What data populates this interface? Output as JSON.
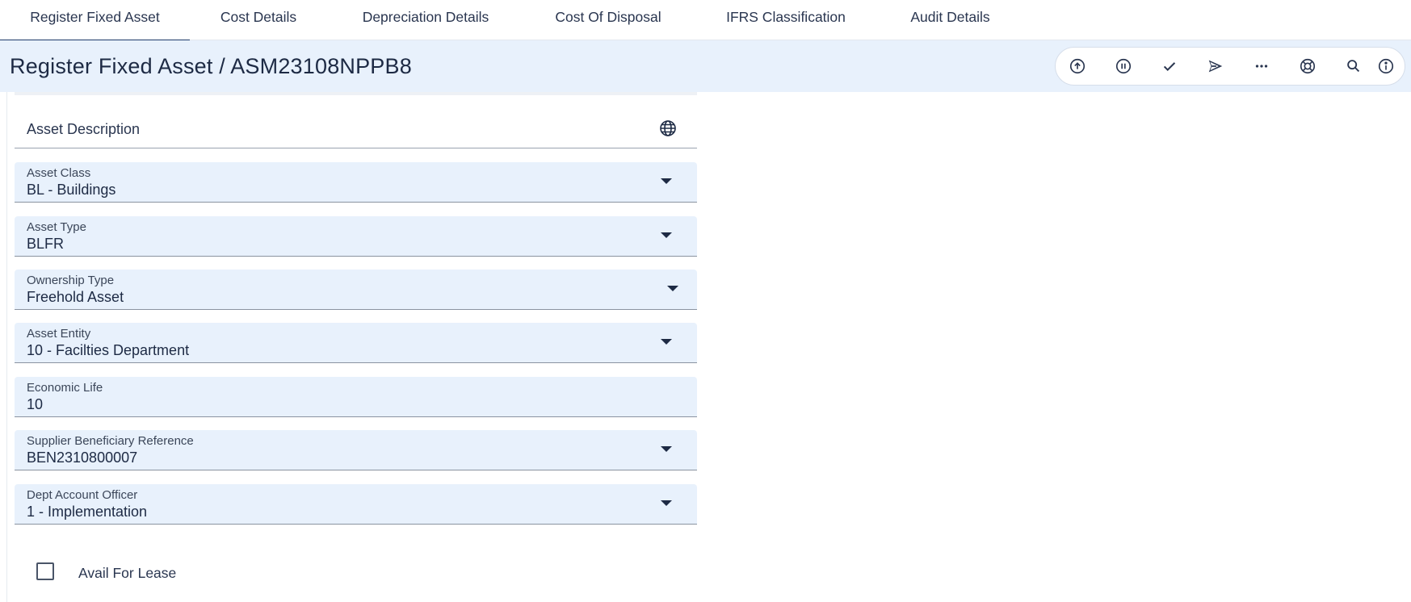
{
  "tabs": [
    {
      "label": "Register Fixed Asset",
      "active": true
    },
    {
      "label": "Cost Details",
      "active": false
    },
    {
      "label": "Depreciation Details",
      "active": false
    },
    {
      "label": "Cost Of Disposal",
      "active": false
    },
    {
      "label": "IFRS Classification",
      "active": false
    },
    {
      "label": "Audit Details",
      "active": false
    }
  ],
  "header": {
    "title": "Register Fixed Asset / ASM23108NPPB8"
  },
  "toolbar": {
    "icons": [
      "upload-icon",
      "pause-icon",
      "check-icon",
      "send-icon",
      "more-icon",
      "lifebuoy-icon",
      "search-icon",
      "info-icon"
    ]
  },
  "form": {
    "asset_description_label": "Asset Description",
    "fields": [
      {
        "label": "Asset Class",
        "value": "BL - Buildings",
        "dropdown": true
      },
      {
        "label": "Asset Type",
        "value": "BLFR",
        "dropdown": true
      },
      {
        "label": "Ownership Type",
        "value": "Freehold Asset",
        "dropdown": true
      },
      {
        "label": "Asset Entity",
        "value": "10 - Facilties Department",
        "dropdown": true
      },
      {
        "label": "Economic Life",
        "value": "10",
        "dropdown": false
      },
      {
        "label": "Supplier Beneficiary Reference",
        "value": "BEN2310800007",
        "dropdown": true
      },
      {
        "label": "Dept Account Officer",
        "value": "1 - Implementation",
        "dropdown": true
      }
    ],
    "avail_for_lease": {
      "label": "Avail For Lease",
      "checked": false
    }
  },
  "colors": {
    "accent": "#1f3a6a",
    "field_bg": "#e8f1fc",
    "header_bg": "#e8f1fc"
  }
}
